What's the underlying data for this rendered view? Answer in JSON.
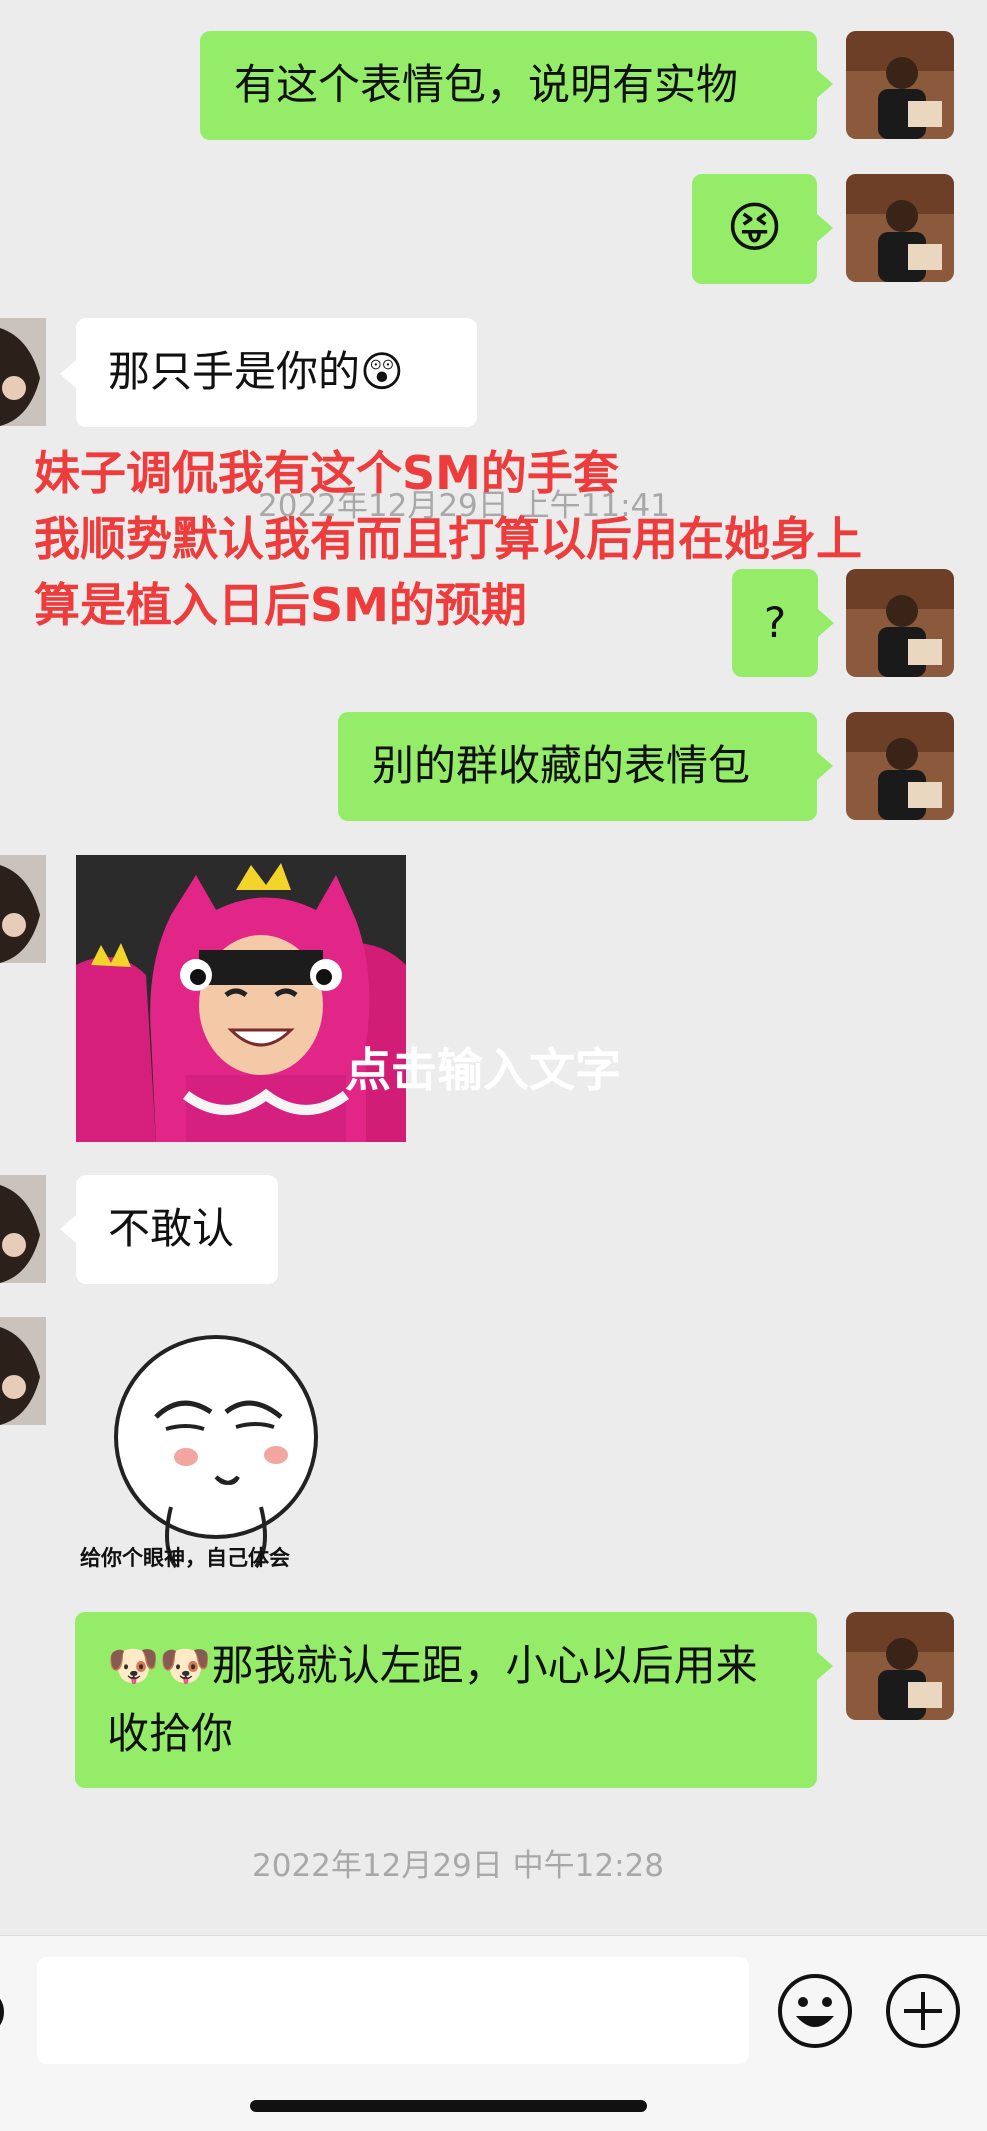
{
  "messages": [
    {
      "id": "m1",
      "side": "right",
      "type": "text",
      "text": "有这个表情包，说明有实物"
    },
    {
      "id": "m2",
      "side": "right",
      "type": "emoji",
      "emoji": "😝"
    },
    {
      "id": "m3",
      "side": "left",
      "type": "text",
      "text": "那只手是你的",
      "emoji": "😲"
    },
    {
      "id": "m4",
      "side": "right",
      "type": "text",
      "text": "?"
    },
    {
      "id": "m5",
      "side": "right",
      "type": "text",
      "text": "别的群收藏的表情包"
    },
    {
      "id": "m6",
      "side": "left",
      "type": "image",
      "overlay_text": "点击输入文字"
    },
    {
      "id": "m7",
      "side": "left",
      "type": "text",
      "text": "不敢认"
    },
    {
      "id": "m8",
      "side": "left",
      "type": "sticker",
      "caption": "给你个眼神，自己体会"
    },
    {
      "id": "m9",
      "side": "right",
      "type": "text",
      "emoji": "🐶🐶",
      "text": "那我就认左距，小心以后用来收拾你"
    }
  ],
  "timestamps": {
    "hidden": "2022年12月29日 上午11:41",
    "main": "2022年12月29日 中午12:28"
  },
  "annotation": {
    "lines": [
      "妹子调侃我有这个SM的手套",
      "我顺势默认我有而且打算以后用在她身上",
      "算是植入日后SM的预期"
    ]
  },
  "colors": {
    "green_bubble": "#95ec69",
    "annotation_red": "#ee3b3b",
    "background": "#ececec"
  },
  "icons": {
    "emoji_button": "emoji-icon",
    "plus_button": "plus-icon"
  }
}
